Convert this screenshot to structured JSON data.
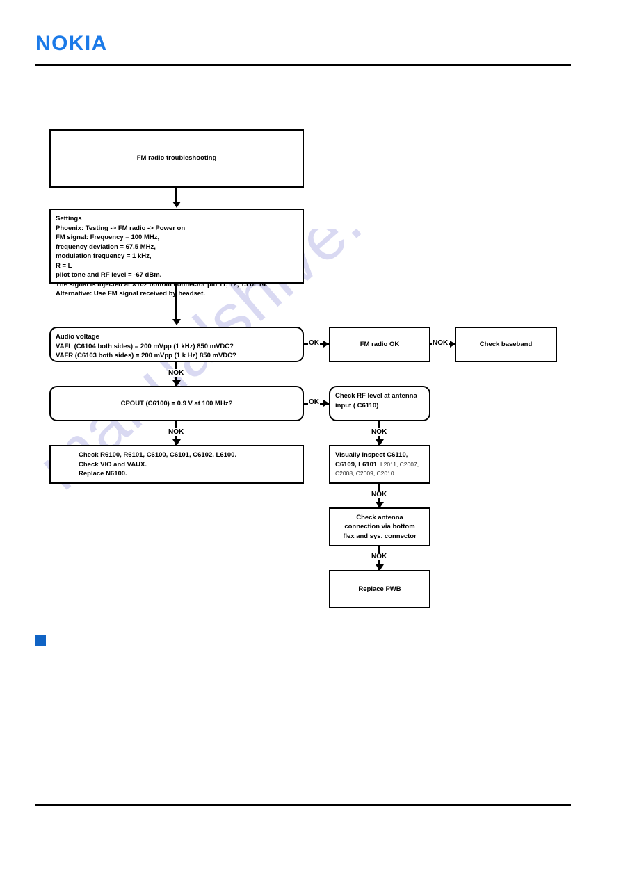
{
  "header": {
    "brand": "NOKIA"
  },
  "watermark": {
    "text": "manualshive.com"
  },
  "flowchart": {
    "title": "FM radio troubleshooting",
    "nodes": {
      "start": {
        "label": "FM radio troubleshooting"
      },
      "settings": {
        "lines": [
          "Settings",
          "Phoenix: Testing -> FM radio -> Power on",
          "FM signal: Frequency = 100 MHz,",
          "frequency deviation = 67.5 MHz,",
          "modulation frequency = 1 kHz,",
          "R = L",
          "pilot tone and RF level = -67 dBm.",
          "The signal is injected at X102 bottom connector pin 11, 12, 13 or 14.",
          "Alternative: Use FM signal received by headset."
        ]
      },
      "audio_voltage": {
        "lines": [
          "Audio voltage",
          "VAFL (C6104 both sides)  = 200 mVpp (1 kHz) 850 mVDC?",
          "VAFR (C6103 both sides) = 200 mVpp (1 k Hz) 850 mVDC?"
        ]
      },
      "fm_radio_ok": {
        "label": "FM radio OK"
      },
      "check_baseband": {
        "label": "Check baseband"
      },
      "cpout": {
        "label": "CPOUT (C6100) = 0.9 V at 100 MHz?"
      },
      "check_rf_level": {
        "lines": [
          "Check RF level at antenna",
          "input ( C6110)"
        ]
      },
      "check_components": {
        "lines": [
          "Check R6100, R6101, C6100, C6101, C6102, L6100.",
          "Check VIO and VAUX.",
          "Replace N6100."
        ]
      },
      "visual_inspect": {
        "bold_lead": "Visually inspect C6110,",
        "bold_second": "C6109, L6101",
        "dim_tail": ", L2011, C2007,",
        "dim_last": "C2008, C2009, C2010"
      },
      "check_antenna": {
        "lines": [
          "Check antenna",
          "connection via bottom",
          "flex and sys. connector"
        ]
      },
      "replace_pwb": {
        "label": "Replace PWB"
      }
    },
    "edges": {
      "ok_audio": "OK",
      "nok_fm_ok": "NOK",
      "nok_audio": "NOK",
      "ok_cpout": "OK",
      "nok_cpout": "NOK",
      "nok_rf": "NOK",
      "nok_visual": "NOK",
      "nok_antenna": "NOK"
    }
  },
  "colors": {
    "brand_blue": "#1b7ae8",
    "marker_blue": "#1063c4",
    "watermark": "#d9d9f2",
    "line": "#000000"
  }
}
